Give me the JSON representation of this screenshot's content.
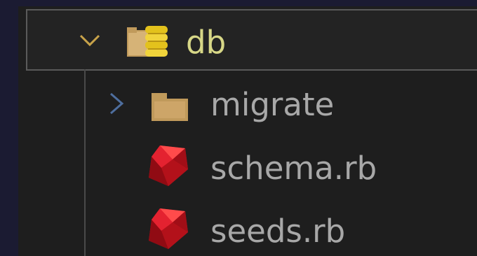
{
  "explorer": {
    "folder_root": {
      "name": "db",
      "expanded": true,
      "icon": "database-folder-icon"
    },
    "children": [
      {
        "name": "migrate",
        "type": "folder",
        "expanded": false,
        "icon": "folder-icon"
      },
      {
        "name": "schema.rb",
        "type": "file",
        "icon": "ruby-icon"
      },
      {
        "name": "seeds.rb",
        "type": "file",
        "icon": "ruby-icon"
      }
    ]
  },
  "colors": {
    "background_outer": "#1b1b32",
    "panel": "#1e1e1e",
    "selected_border": "#5a5a5a",
    "db_label": "#d7d787",
    "item_label": "#a8a8a8",
    "ruby_red": "#c8141e",
    "folder_tan": "#c09a5b"
  }
}
